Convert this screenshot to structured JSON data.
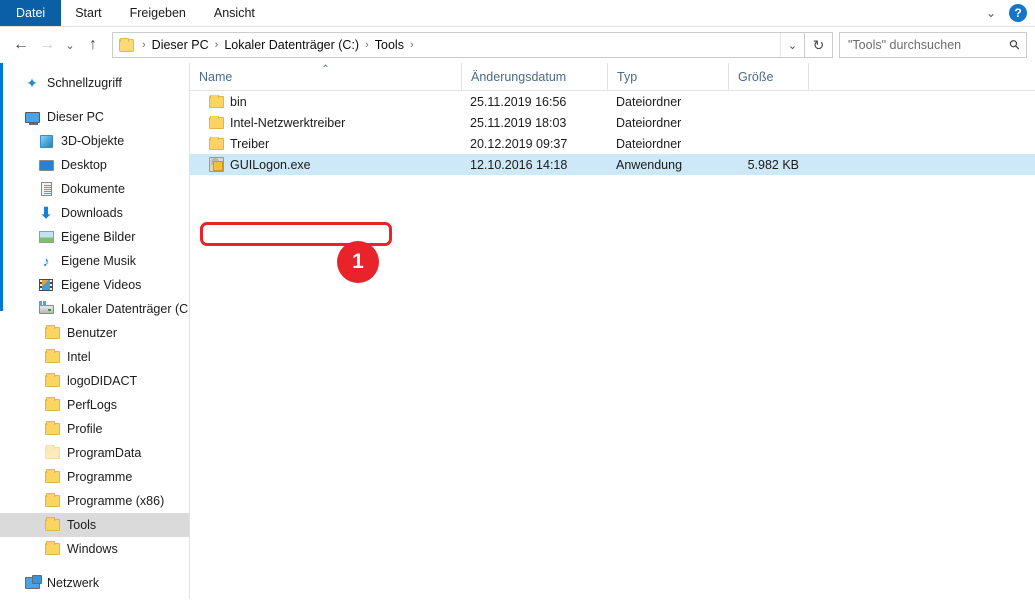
{
  "window": {
    "help_label": "?",
    "ribbon_chevron": "⌄"
  },
  "ribbon": {
    "tabs": [
      {
        "label": "Datei",
        "active": true
      },
      {
        "label": "Start",
        "active": false
      },
      {
        "label": "Freigeben",
        "active": false
      },
      {
        "label": "Ansicht",
        "active": false
      }
    ]
  },
  "navbar": {
    "back_icon": "←",
    "forward_icon": "→",
    "recent_icon": "⌄",
    "up_icon": "↑",
    "refresh_icon": "↻",
    "address_chevron": "⌄",
    "breadcrumbs": [
      {
        "label": "Dieser PC"
      },
      {
        "label": "Lokaler Datenträger (C:)"
      },
      {
        "label": "Tools"
      }
    ],
    "breadcrumb_separator": "›"
  },
  "search": {
    "placeholder": "\"Tools\" durchsuchen",
    "value": "",
    "icon": "search-icon"
  },
  "sidebar": {
    "items": [
      {
        "label": "Schnellzugriff",
        "icon": "star-icon",
        "level": 0,
        "selected": false
      },
      {
        "label": "Dieser PC",
        "icon": "computer-icon",
        "level": 0,
        "selected": false
      },
      {
        "label": "3D-Objekte",
        "icon": "3d-objects-icon",
        "level": 1,
        "selected": false
      },
      {
        "label": "Desktop",
        "icon": "desktop-icon",
        "level": 1,
        "selected": false
      },
      {
        "label": "Dokumente",
        "icon": "documents-icon",
        "level": 1,
        "selected": false
      },
      {
        "label": "Downloads",
        "icon": "downloads-icon",
        "level": 1,
        "selected": false
      },
      {
        "label": "Eigene Bilder",
        "icon": "pictures-icon",
        "level": 1,
        "selected": false
      },
      {
        "label": "Eigene Musik",
        "icon": "music-icon",
        "level": 1,
        "selected": false
      },
      {
        "label": "Eigene Videos",
        "icon": "videos-icon",
        "level": 1,
        "selected": false
      },
      {
        "label": "Lokaler Datenträger (C:)",
        "icon": "drive-icon",
        "level": 1,
        "selected": false
      },
      {
        "label": "Benutzer",
        "icon": "folder-icon",
        "level": 2,
        "selected": false
      },
      {
        "label": "Intel",
        "icon": "folder-icon",
        "level": 2,
        "selected": false
      },
      {
        "label": "logoDIDACT",
        "icon": "folder-icon",
        "level": 2,
        "selected": false
      },
      {
        "label": "PerfLogs",
        "icon": "folder-icon",
        "level": 2,
        "selected": false
      },
      {
        "label": "Profile",
        "icon": "folder-icon",
        "level": 2,
        "selected": false
      },
      {
        "label": "ProgramData",
        "icon": "folder-icon-hidden",
        "level": 2,
        "selected": false
      },
      {
        "label": "Programme",
        "icon": "folder-icon",
        "level": 2,
        "selected": false
      },
      {
        "label": "Programme (x86)",
        "icon": "folder-icon",
        "level": 2,
        "selected": false
      },
      {
        "label": "Tools",
        "icon": "folder-icon",
        "level": 2,
        "selected": true
      },
      {
        "label": "Windows",
        "icon": "folder-icon",
        "level": 2,
        "selected": false
      },
      {
        "label": "Netzwerk",
        "icon": "network-icon",
        "level": 0,
        "selected": false
      }
    ]
  },
  "filelist": {
    "columns": [
      {
        "label": "Name",
        "sorted": "asc",
        "sort_glyph": "⌃"
      },
      {
        "label": "Änderungsdatum",
        "sorted": ""
      },
      {
        "label": "Typ",
        "sorted": ""
      },
      {
        "label": "Größe",
        "sorted": ""
      }
    ],
    "rows": [
      {
        "name": "bin",
        "date": "25.11.2019 16:56",
        "type": "Dateiordner",
        "size": "",
        "icon": "folder-icon",
        "selected": false
      },
      {
        "name": "Intel-Netzwerktreiber",
        "date": "25.11.2019 18:03",
        "type": "Dateiordner",
        "size": "",
        "icon": "folder-icon",
        "selected": false
      },
      {
        "name": "Treiber",
        "date": "20.12.2019 09:37",
        "type": "Dateiordner",
        "size": "",
        "icon": "folder-icon",
        "selected": false
      },
      {
        "name": "GUILogon.exe",
        "date": "12.10.2016 14:18",
        "type": "Anwendung",
        "size": "5.982 KB",
        "icon": "application-icon",
        "selected": true
      }
    ]
  },
  "annotation": {
    "badge_number": "1",
    "color": "#e8242a",
    "target": "GUILogon.exe"
  },
  "colors": {
    "accent": "#0078d4",
    "file_tab": "#0b5fa5",
    "selection_blue": "#cde8f7",
    "sidebar_selection": "#dadada",
    "annotation_red": "#e8242a"
  }
}
